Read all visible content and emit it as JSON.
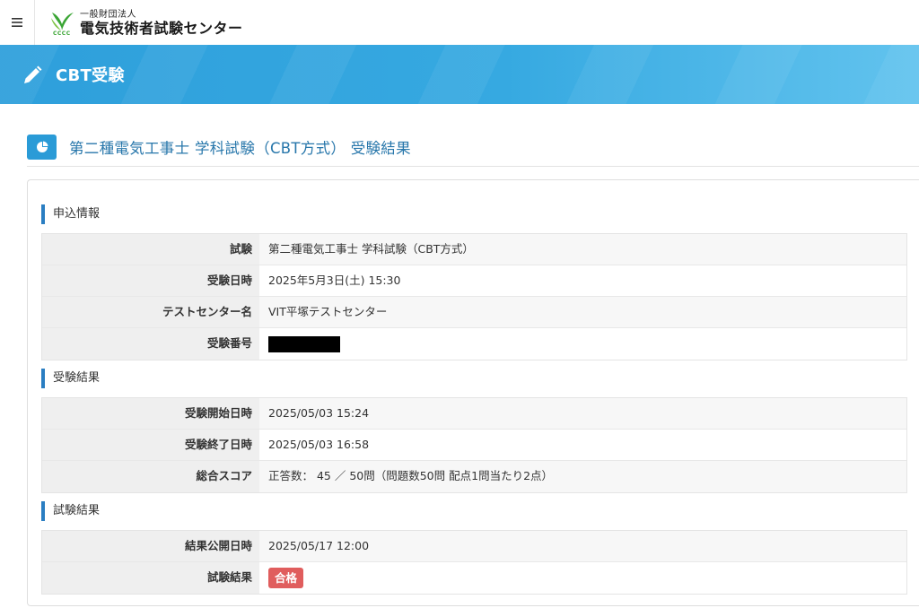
{
  "header": {
    "menu_icon": "hamburger-icon",
    "logo_sub": "一般財団法人",
    "logo_main": "電気技術者試験センター",
    "logo_mark_text": "CCCC"
  },
  "banner": {
    "icon": "pencil-icon",
    "title": "CBT受験",
    "color": "#36a9e1"
  },
  "page": {
    "icon": "pie-chart-icon",
    "title": "第二種電気工事士 学科試験（CBT方式） 受験結果"
  },
  "sections": {
    "application": {
      "label": "申込情報",
      "rows": [
        {
          "label": "試験",
          "value": "第二種電気工事士 学科試験（CBT方式）"
        },
        {
          "label": "受験日時",
          "value": "2025年5月3日(土) 15:30"
        },
        {
          "label": "テストセンター名",
          "value": "VIT平塚テストセンター"
        },
        {
          "label": "受験番号",
          "value": ""
        }
      ]
    },
    "exam": {
      "label": "受験結果",
      "rows": [
        {
          "label": "受験開始日時",
          "value": "2025/05/03 15:24"
        },
        {
          "label": "受験終了日時",
          "value": "2025/05/03 16:58"
        },
        {
          "label": "総合スコア",
          "value": "正答数： 45 ／ 50問（問題数50問 配点1問当たり2点）"
        }
      ]
    },
    "result": {
      "label": "試験結果",
      "rows": [
        {
          "label": "結果公開日時",
          "value": "2025/05/17 12:00"
        },
        {
          "label": "試験結果",
          "value": "合格"
        }
      ]
    }
  },
  "colors": {
    "accent": "#2a7ec2",
    "pass_badge": "#e05d5d",
    "heading_text": "#2877ab"
  }
}
